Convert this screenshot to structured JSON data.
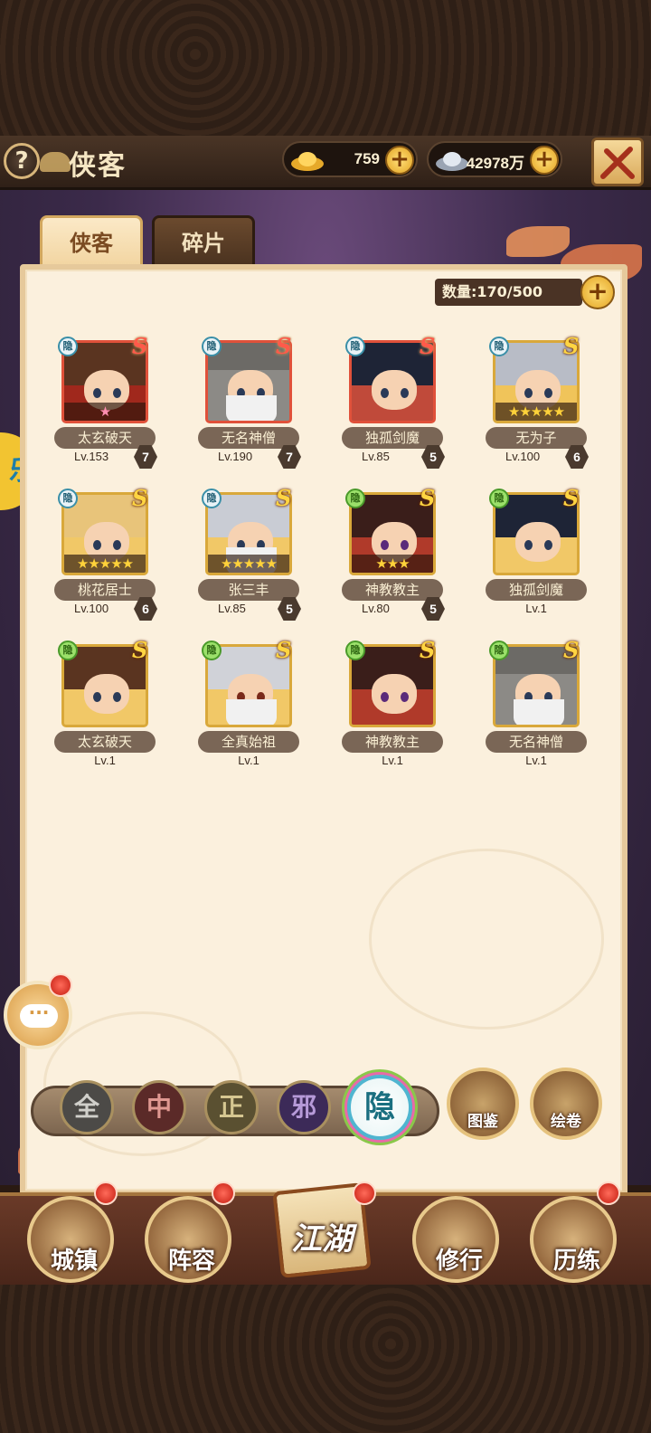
{
  "header": {
    "title": "侠客",
    "help_label": "?",
    "gold": "759",
    "silver": "42978万",
    "plus": "+"
  },
  "tabs": [
    {
      "label": "侠客",
      "active": true
    },
    {
      "label": "碎片",
      "active": false
    }
  ],
  "roster": {
    "count_label": "数量:170/500",
    "heroes": [
      {
        "name": "太玄破天",
        "level": "Lv.153",
        "grade": "7",
        "rank": "S",
        "badge": "隐",
        "stars": "★"
      },
      {
        "name": "无名神僧",
        "level": "Lv.190",
        "grade": "7",
        "rank": "S",
        "badge": "隐",
        "stars": ""
      },
      {
        "name": "独孤剑魔",
        "level": "Lv.85",
        "grade": "5",
        "rank": "S",
        "badge": "隐",
        "stars": ""
      },
      {
        "name": "无为子",
        "level": "Lv.100",
        "grade": "6",
        "rank": "S",
        "badge": "隐",
        "stars": "★★★★★"
      },
      {
        "name": "桃花居士",
        "level": "Lv.100",
        "grade": "6",
        "rank": "S",
        "badge": "隐",
        "stars": "★★★★★"
      },
      {
        "name": "张三丰",
        "level": "Lv.85",
        "grade": "5",
        "rank": "S",
        "badge": "隐",
        "stars": "★★★★★"
      },
      {
        "name": "神教教主",
        "level": "Lv.80",
        "grade": "5",
        "rank": "S",
        "badge": "隐",
        "stars": "★★★"
      },
      {
        "name": "独孤剑魔",
        "level": "Lv.1",
        "grade": "",
        "rank": "S",
        "badge": "隐",
        "stars": ""
      },
      {
        "name": "太玄破天",
        "level": "Lv.1",
        "grade": "",
        "rank": "S",
        "badge": "隐",
        "stars": ""
      },
      {
        "name": "全真始祖",
        "level": "Lv.1",
        "grade": "",
        "rank": "S",
        "badge": "隐",
        "stars": ""
      },
      {
        "name": "神教教主",
        "level": "Lv.1",
        "grade": "",
        "rank": "S",
        "badge": "隐",
        "stars": ""
      },
      {
        "name": "无名神僧",
        "level": "Lv.1",
        "grade": "",
        "rank": "S",
        "badge": "隐",
        "stars": ""
      }
    ]
  },
  "filters": {
    "all": "全",
    "middle": "中",
    "righteous": "正",
    "evil": "邪",
    "hidden": "隐",
    "codex": "图鉴",
    "scroll": "绘卷"
  },
  "side_tab_char": "乐",
  "chat_label": "···",
  "nav": {
    "town": "城镇",
    "lineup": "阵容",
    "jianghu": "江湖",
    "training": "修行",
    "trial": "历练"
  },
  "colors": {
    "accent_gold": "#e3a322",
    "panel_bg": "#fbf0dd",
    "rank_red": "#ff5a4a",
    "rank_gold": "#ffd542"
  }
}
